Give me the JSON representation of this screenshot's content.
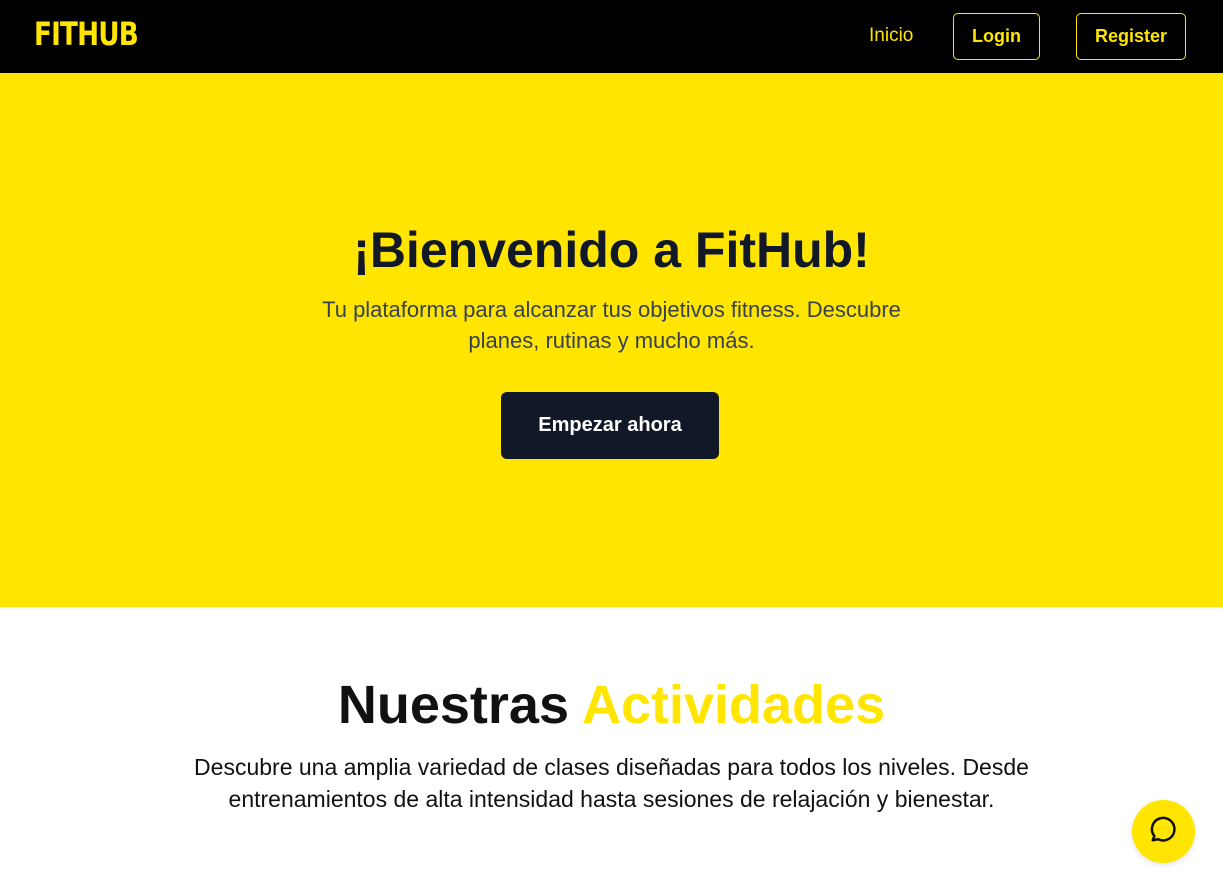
{
  "navbar": {
    "logo": "FITHUB",
    "inicio_label": "Inicio",
    "login_label": "Login",
    "register_label": "Register"
  },
  "hero": {
    "title": "¡Bienvenido a FitHub!",
    "subtitle": "Tu plataforma para alcanzar tus objetivos fitness. Descubre planes, rutinas y mucho más.",
    "cta_label": "Empezar ahora"
  },
  "activities": {
    "title_part1": "Nuestras",
    "title_part2": "Actividades",
    "description": "Descubre una amplia variedad de clases diseñadas para todos los niveles. Desde entrenamientos de alta intensidad hasta sesiones de relajación y bienestar."
  },
  "chat": {
    "icon": "chat-bubble-icon"
  },
  "colors": {
    "brand_yellow": "#ffe500",
    "nav_black": "#000000",
    "dark_button": "#111827",
    "text_dark": "#111111"
  }
}
